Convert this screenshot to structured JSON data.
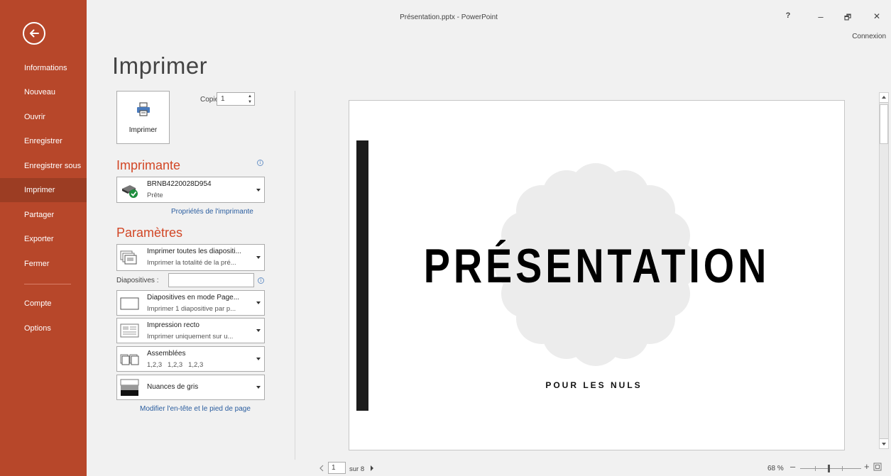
{
  "window": {
    "title": "Présentation.pptx - PowerPoint",
    "help": "?",
    "minimize": "–",
    "restore": "🗗",
    "close": "✕",
    "signin": "Connexion"
  },
  "sidebar": {
    "items": [
      {
        "label": "Informations"
      },
      {
        "label": "Nouveau"
      },
      {
        "label": "Ouvrir"
      },
      {
        "label": "Enregistrer"
      },
      {
        "label": "Enregistrer sous"
      },
      {
        "label": "Imprimer",
        "active": true
      },
      {
        "label": "Partager"
      },
      {
        "label": "Exporter"
      },
      {
        "label": "Fermer"
      },
      {
        "label": "Compte"
      },
      {
        "label": "Options"
      }
    ]
  },
  "print": {
    "page_title": "Imprimer",
    "button_label": "Imprimer",
    "copies_label": "Copies :",
    "copies_value": "1"
  },
  "printer": {
    "heading": "Imprimante",
    "name": "BRNB4220028D954",
    "status": "Prête",
    "properties_link": "Propriétés de l'imprimante"
  },
  "settings": {
    "heading": "Paramètres",
    "slides_scope": {
      "line1": "Imprimer toutes les diapositi...",
      "line2": "Imprimer la totalité de la pré..."
    },
    "slides_label": "Diapositives :",
    "slides_value": "",
    "layout": {
      "line1": "Diapositives en mode Page...",
      "line2": "Imprimer 1 diapositive par p..."
    },
    "sides": {
      "line1": "Impression recto",
      "line2": "Imprimer uniquement sur u..."
    },
    "collation": {
      "line1": "Assemblées",
      "line2": "1,2,3   1,2,3   1,2,3"
    },
    "color": {
      "line1": "Nuances de gris"
    },
    "header_footer_link": "Modifier l'en-tête et le pied de page"
  },
  "preview": {
    "slide_title": "PRÉSENTATION",
    "slide_subtitle": "POUR LES NULS",
    "current_page": "1",
    "page_of": "sur 8",
    "zoom": "68 %",
    "zoom_minus": "–",
    "zoom_plus": "+"
  },
  "colors": {
    "sidebar": "#b7472a",
    "sidebar_active": "#9c3d23",
    "accent": "#d24726",
    "link": "#2a5d9f"
  }
}
